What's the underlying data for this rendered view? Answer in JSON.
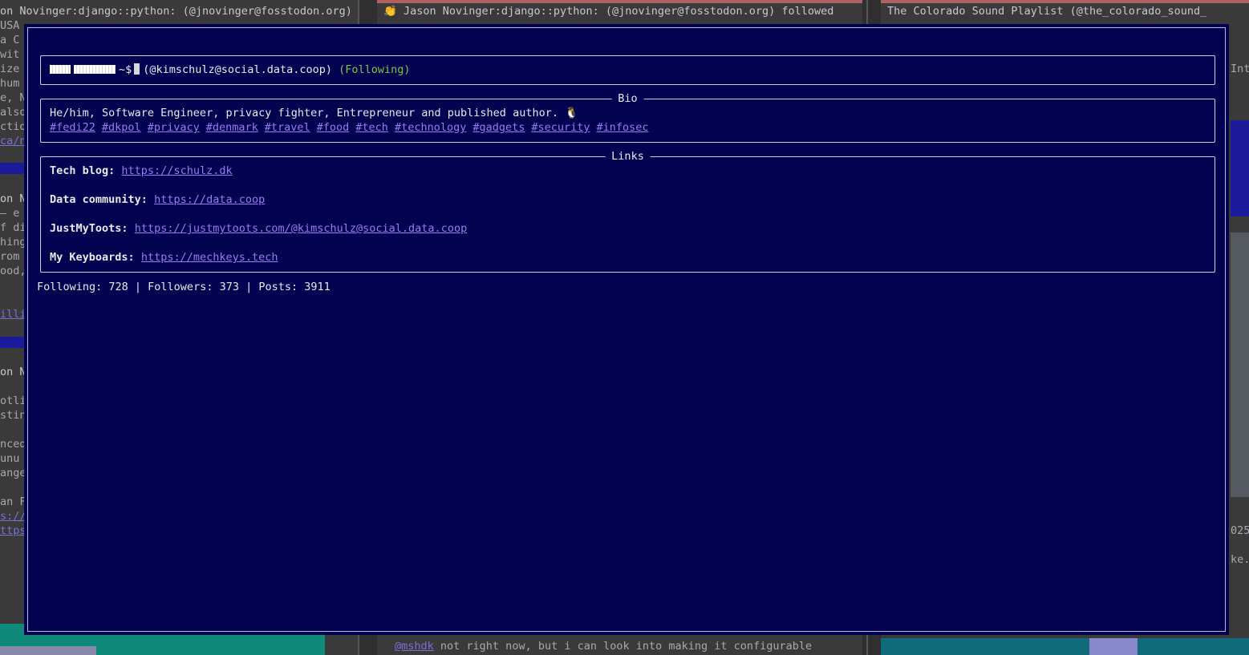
{
  "background": {
    "left_pane": {
      "lines": [
        "on Novinger:django::python: (@jnovinger@fosstodon.org)",
        "USA",
        "a C",
        "wit",
        "ize",
        "hum",
        "e, N",
        "also",
        "ctio",
        "ca/n",
        "on N",
        "— e",
        "f di",
        "hing",
        "rom",
        "ood,",
        "illi",
        "on N",
        "otli",
        "stin",
        "nced",
        "unu",
        "ange",
        "an F",
        "s://p",
        "ttps"
      ]
    },
    "middle_pane": {
      "top_line": "👏 Jason Novinger:django::python: (@jnovinger@fosstodon.org) followed",
      "bottom_mention": "@mshdk",
      "bottom_text": " not right now, but i can look into making it configurable"
    },
    "right_pane": {
      "top_line": "The Colorado Sound Playlist (@the_colorado_sound_",
      "fragments": [
        "Int",
        "025",
        "ke."
      ]
    }
  },
  "profile": {
    "prompt": "~$",
    "handle": "(@kimschulz@social.data.coop)",
    "relationship": "(Following)"
  },
  "bio": {
    "title": "Bio",
    "text": "He/him, Software Engineer, privacy fighter, Entrepreneur and published author. 🐧",
    "hashtags": [
      "#fedi22",
      "#dkpol",
      "#privacy",
      "#denmark",
      "#travel",
      "#food",
      "#tech",
      "#technology",
      "#gadgets",
      "#security",
      "#infosec"
    ]
  },
  "links": {
    "title": "Links",
    "items": [
      {
        "label": "Tech blog:",
        "url": "https://schulz.dk"
      },
      {
        "label": "Data community:",
        "url": "https://data.coop"
      },
      {
        "label": "JustMyToots:",
        "url": "https://justmytoots.com/@kimschulz@social.data.coop"
      },
      {
        "label": "My Keyboards:",
        "url": "https://mechkeys.tech"
      }
    ]
  },
  "stats": {
    "text": "Following: 728 | Followers: 373 | Posts: 3911"
  },
  "colors": {
    "modal_bg": "#020250",
    "link": "#9a7bf0",
    "following": "#7ac943",
    "text": "#e8e8ee"
  }
}
